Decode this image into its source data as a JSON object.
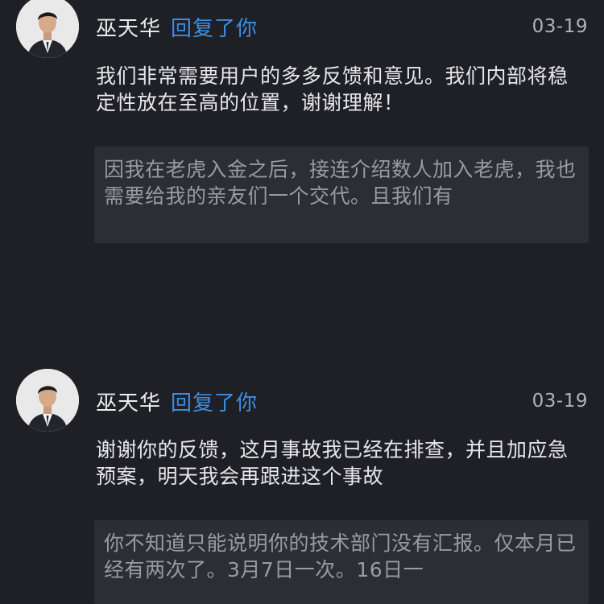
{
  "comments": [
    {
      "author": "巫天华",
      "reply_tag": "回复了你",
      "date": "03-19",
      "body": "我们非常需要用户的多多反馈和意见。我们内部将稳定性放在至高的位置，谢谢理解！",
      "quote": "因我在老虎入金之后，接连介绍数人加入老虎，我也需要给我的亲友们一个交代。且我们有"
    },
    {
      "author": "巫天华",
      "reply_tag": "回复了你",
      "date": "03-19",
      "body": "谢谢你的反馈，这月事故我已经在排查，并且加应急预案，明天我会再跟进这个事故",
      "quote": "你不知道只能说明你的技术部门没有汇报。仅本月已经有两次了。3月7日一次。16日一"
    }
  ],
  "colors": {
    "background": "#1f1f26",
    "author": "#ececec",
    "reply_tag": "#3d8ee0",
    "date": "#b2b2b5",
    "body_text": "#e7e7e9",
    "quote_background": "#2d2d36",
    "quote_text": "#9a9a9f"
  }
}
